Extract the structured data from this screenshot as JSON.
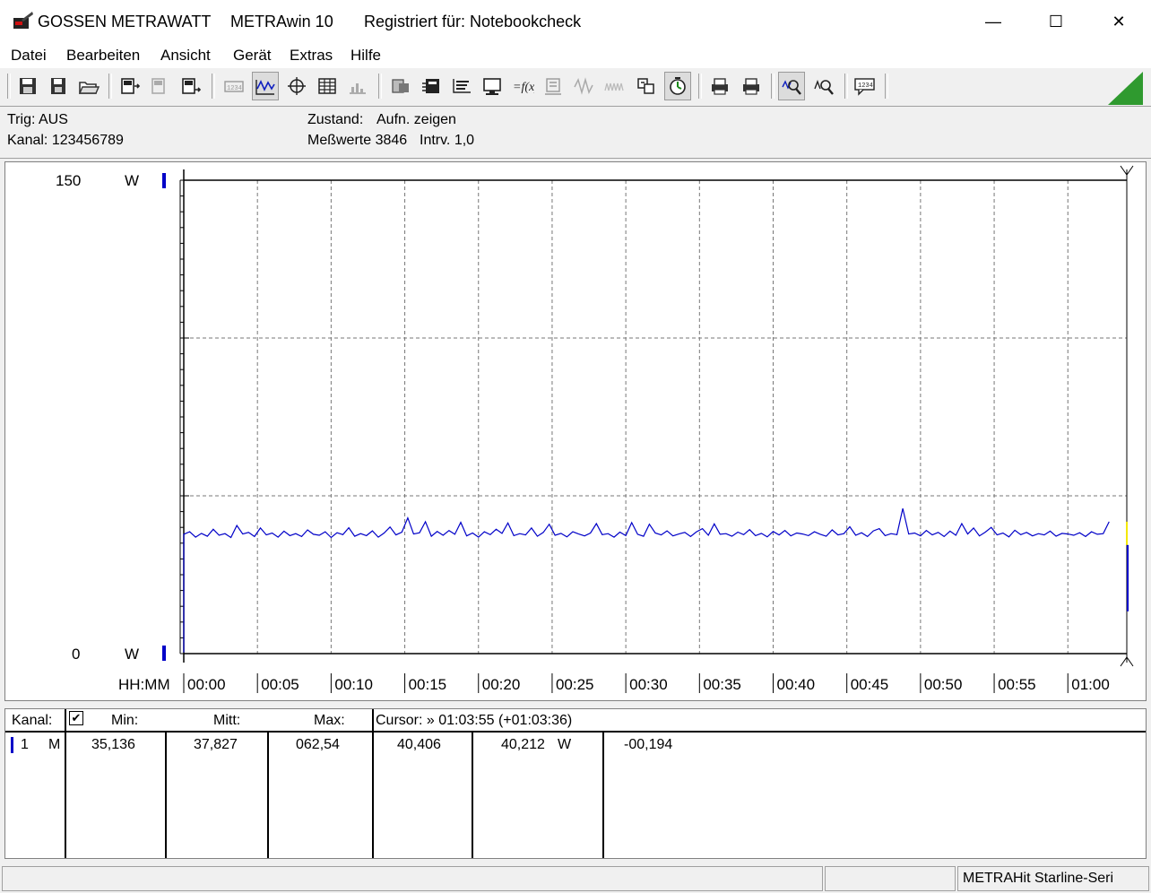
{
  "window": {
    "brand": "GOSSEN METRAWATT",
    "app_name": "METRAwin 10",
    "registered": "Registriert für: Notebookcheck",
    "minimize": "—",
    "maximize": "☐",
    "close": "✕"
  },
  "menu": [
    "Datei",
    "Bearbeiten",
    "Ansicht",
    "Gerät",
    "Extras",
    "Hilfe"
  ],
  "toolbar_icons": [
    "save-icon",
    "save-as-icon",
    "open-folder-icon",
    "device-read-icon",
    "device-disabled-icon",
    "device-export-icon",
    "digital-display-icon",
    "waveform-view-icon",
    "cursor-crosshair-icon",
    "table-view-icon",
    "bar-view-icon",
    "channel-setup-icon",
    "scope-icon",
    "recorder-icon",
    "monitor-icon",
    "formula-icon",
    "memory-icon",
    "signal-icon",
    "wave-disabled-icon",
    "transfer-icon",
    "timer-icon",
    "print-preview-icon",
    "print-icon",
    "zoom-in-icon",
    "zoom-fit-icon",
    "comment-icon"
  ],
  "info": {
    "trig": "Trig: AUS",
    "kanal": "Kanal: 123456789",
    "zustand_label": "Zustand:",
    "zustand_value": "Aufn. zeigen",
    "messwerte": "Meßwerte 3846",
    "intervall": "Intrv. 1,0"
  },
  "chart_data": {
    "type": "line",
    "title": "",
    "xlabel": "HH:MM",
    "ylabel": "",
    "y_unit": "W",
    "ylim": [
      0,
      150
    ],
    "y_tick_labels": [
      "150",
      "0"
    ],
    "x_tick_labels": [
      "00:00",
      "00:05",
      "00:10",
      "00:15",
      "00:20",
      "00:25",
      "00:30",
      "00:35",
      "00:40",
      "00:45",
      "00:50",
      "00:55",
      "01:00"
    ],
    "x_minutes_range": [
      0,
      64
    ],
    "grid": true,
    "series": [
      {
        "color": "#0000c8",
        "x_minutes": [
          0.0,
          0.4,
          0.8,
          1.2,
          1.6,
          2.0,
          2.4,
          2.8,
          3.2,
          3.6,
          4.0,
          4.4,
          4.8,
          5.2,
          5.6,
          6.0,
          6.4,
          6.8,
          7.2,
          7.6,
          8.0,
          8.4,
          8.8,
          9.2,
          9.6,
          10.0,
          10.4,
          10.8,
          11.2,
          11.6,
          12.0,
          12.4,
          12.8,
          13.2,
          13.6,
          14.0,
          14.4,
          14.8,
          15.2,
          15.6,
          16.0,
          16.4,
          16.8,
          17.2,
          17.6,
          18.0,
          18.4,
          18.8,
          19.2,
          19.6,
          20.0,
          20.4,
          20.8,
          21.2,
          21.6,
          22.0,
          22.4,
          22.8,
          23.2,
          23.6,
          24.0,
          24.4,
          24.8,
          25.2,
          25.6,
          26.0,
          26.4,
          26.8,
          27.2,
          27.6,
          28.0,
          28.4,
          28.8,
          29.2,
          29.6,
          30.0,
          30.4,
          30.8,
          31.2,
          31.6,
          32.0,
          32.4,
          32.8,
          33.2,
          33.6,
          34.0,
          34.4,
          34.8,
          35.2,
          35.6,
          36.0,
          36.4,
          36.8,
          37.2,
          37.6,
          38.0,
          38.4,
          38.8,
          39.2,
          39.6,
          40.0,
          40.4,
          40.8,
          41.2,
          41.6,
          42.0,
          42.4,
          42.8,
          43.2,
          43.6,
          44.0,
          44.4,
          44.8,
          45.2,
          45.6,
          46.0,
          46.4,
          46.8,
          47.2,
          47.6,
          48.0,
          48.4,
          48.8,
          49.2,
          49.6,
          50.0,
          50.4,
          50.8,
          51.2,
          51.6,
          52.0,
          52.4,
          52.8,
          53.2,
          53.6,
          54.0,
          54.4,
          54.8,
          55.2,
          55.6,
          56.0,
          56.4,
          56.8,
          57.2,
          57.6,
          58.0,
          58.4,
          58.8,
          59.2,
          59.6,
          60.0,
          60.4,
          60.8,
          61.2,
          61.6,
          62.0,
          62.4,
          62.8,
          63.2,
          63.6
        ],
        "values": [
          37.8,
          38.6,
          36.9,
          38.1,
          37.2,
          39.4,
          37.5,
          38.0,
          36.8,
          40.6,
          37.9,
          38.4,
          37.1,
          39.8,
          37.6,
          38.2,
          36.9,
          38.8,
          37.4,
          38.0,
          37.1,
          39.2,
          37.8,
          37.5,
          38.6,
          36.8,
          38.3,
          37.7,
          39.9,
          37.2,
          38.0,
          37.4,
          38.9,
          36.9,
          38.2,
          40.1,
          37.6,
          38.5,
          43.0,
          37.9,
          38.3,
          41.8,
          37.2,
          38.7,
          37.5,
          39.0,
          37.8,
          41.6,
          37.3,
          38.2,
          36.9,
          38.6,
          37.7,
          39.4,
          38.1,
          41.4,
          37.4,
          38.0,
          37.6,
          39.8,
          37.2,
          38.4,
          41.0,
          37.5,
          38.1,
          37.0,
          38.6,
          37.9,
          37.3,
          38.2,
          41.2,
          37.7,
          38.0,
          36.9,
          38.5,
          37.4,
          41.5,
          37.8,
          37.2,
          41.0,
          38.2,
          37.6,
          38.9,
          37.3,
          37.9,
          38.4,
          37.1,
          38.6,
          39.6,
          37.5,
          41.1,
          37.8,
          38.0,
          37.2,
          38.5,
          37.7,
          39.3,
          37.4,
          38.1,
          37.0,
          38.7,
          37.6,
          39.0,
          37.3,
          38.2,
          37.9,
          37.4,
          38.6,
          37.8,
          37.2,
          39.2,
          37.6,
          38.0,
          40.2,
          37.5,
          38.3,
          37.1,
          38.9,
          39.6,
          37.4,
          38.0,
          37.7,
          46.0,
          37.9,
          38.2,
          37.3,
          39.0,
          37.6,
          38.4,
          37.1,
          38.8,
          37.5,
          41.2,
          37.9,
          39.8,
          37.3,
          38.5,
          40.0,
          37.6,
          38.2,
          37.0,
          39.1,
          37.7,
          38.4,
          37.3,
          38.0,
          37.6,
          38.8,
          37.2,
          38.1,
          37.9,
          37.5,
          38.3,
          37.1,
          38.6,
          37.8,
          38.0,
          41.8
        ]
      }
    ]
  },
  "table": {
    "headers": {
      "kanal": "Kanal:",
      "min": "Min:",
      "mitt": "Mitt:",
      "max": "Max:",
      "cursor": "Cursor: » 01:03:55 (+01:03:36)"
    },
    "row": {
      "channel": "1",
      "mode": "M",
      "min": "35,136",
      "mitt": "37,827",
      "max": "062,54",
      "c1": "40,406",
      "c2": "40,212",
      "unit": "W",
      "diff": "-00,194"
    }
  },
  "status": {
    "device": "METRAHit Starline-Seri"
  }
}
